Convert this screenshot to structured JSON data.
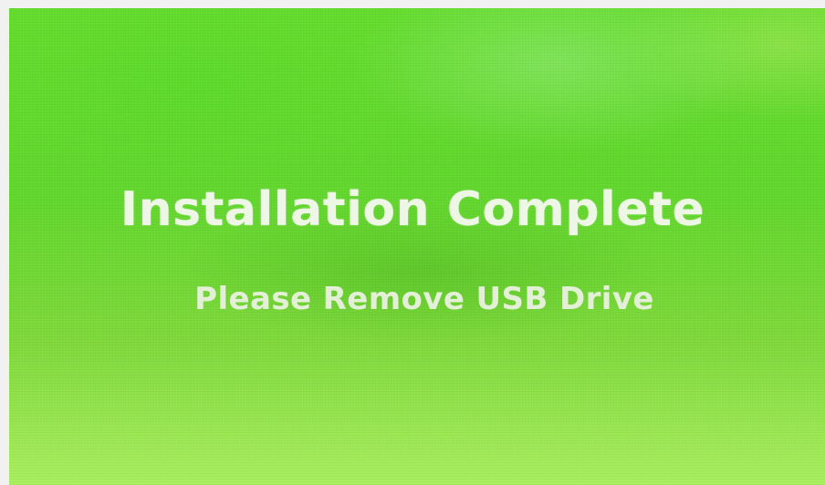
{
  "message": {
    "title": "Installation Complete",
    "subtitle": "Please Remove USB Drive"
  },
  "colors": {
    "background_green": "#64dc2d",
    "background_light_green": "#a9ef5f",
    "text": "#eef7e6"
  }
}
